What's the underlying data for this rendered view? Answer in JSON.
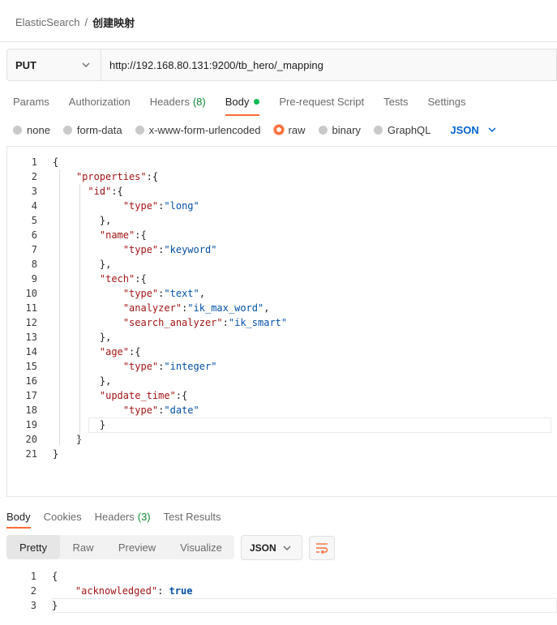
{
  "breadcrumb": {
    "parent": "ElasticSearch",
    "separator": "/",
    "current": "创建映射"
  },
  "request": {
    "method": "PUT",
    "url": "http://192.168.80.131:9200/tb_hero/_mapping"
  },
  "request_tabs": [
    {
      "label": "Params"
    },
    {
      "label": "Authorization"
    },
    {
      "label": "Headers",
      "count": "(8)"
    },
    {
      "label": "Body",
      "active": true
    },
    {
      "label": "Pre-request Script"
    },
    {
      "label": "Tests"
    },
    {
      "label": "Settings"
    }
  ],
  "body_types": [
    "none",
    "form-data",
    "x-www-form-urlencoded",
    "raw",
    "binary",
    "GraphQL"
  ],
  "body_type_selected": "raw",
  "body_format": "JSON",
  "request_body_lines": [
    {
      "n": "1",
      "text": "{"
    },
    {
      "n": "2",
      "text": "    \"properties\":{"
    },
    {
      "n": "3",
      "text": "      \"id\":{"
    },
    {
      "n": "4",
      "text": "            \"type\":\"long\""
    },
    {
      "n": "5",
      "text": "        },"
    },
    {
      "n": "6",
      "text": "        \"name\":{"
    },
    {
      "n": "7",
      "text": "            \"type\":\"keyword\""
    },
    {
      "n": "8",
      "text": "        },"
    },
    {
      "n": "9",
      "text": "        \"tech\":{"
    },
    {
      "n": "10",
      "text": "            \"type\":\"text\","
    },
    {
      "n": "11",
      "text": "            \"analyzer\":\"ik_max_word\","
    },
    {
      "n": "12",
      "text": "            \"search_analyzer\":\"ik_smart\""
    },
    {
      "n": "13",
      "text": "        },"
    },
    {
      "n": "14",
      "text": "        \"age\":{"
    },
    {
      "n": "15",
      "text": "            \"type\":\"integer\""
    },
    {
      "n": "16",
      "text": "        },"
    },
    {
      "n": "17",
      "text": "        \"update_time\":{"
    },
    {
      "n": "18",
      "text": "            \"type\":\"date\""
    },
    {
      "n": "19",
      "text": "        }"
    },
    {
      "n": "20",
      "text": "    }"
    },
    {
      "n": "21",
      "text": "}"
    }
  ],
  "response_tabs": [
    {
      "label": "Body",
      "active": true
    },
    {
      "label": "Cookies"
    },
    {
      "label": "Headers",
      "count": "(3)"
    },
    {
      "label": "Test Results"
    }
  ],
  "view_modes": [
    "Pretty",
    "Raw",
    "Preview",
    "Visualize"
  ],
  "view_mode_selected": "Pretty",
  "response_format": "JSON",
  "response_lines": [
    {
      "n": "1",
      "text": "{"
    },
    {
      "n": "2",
      "key": "\"acknowledged\"",
      "sep": ": ",
      "val": "true"
    },
    {
      "n": "3",
      "text": "}"
    }
  ],
  "colors": {
    "accent": "#ff6c37",
    "link_blue": "#0265d2",
    "key_red": "#a31515",
    "value_blue": "#0451a5",
    "success_green": "#0cbb52"
  },
  "icons": {
    "method_dropdown": "chevron-down-icon",
    "format_dropdown": "chevron-down-icon",
    "wrap": "wrap-lines-icon"
  }
}
